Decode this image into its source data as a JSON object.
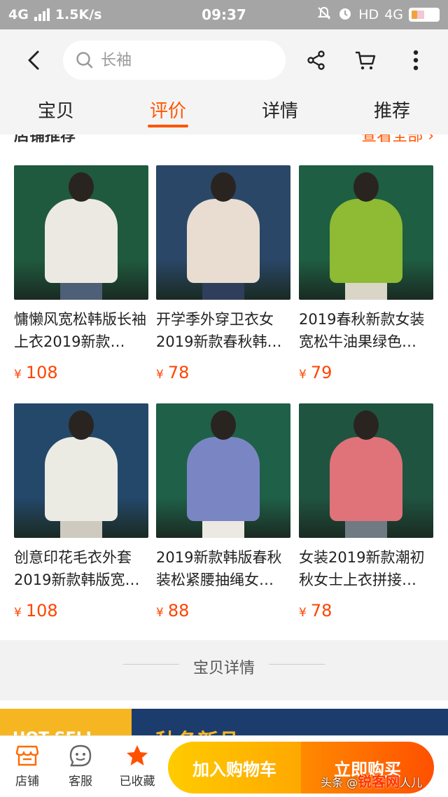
{
  "status_bar": {
    "network": "4G",
    "speed": "1.5K/s",
    "time": "09:37",
    "hd": "HD",
    "network_right": "4G"
  },
  "header": {
    "search_placeholder": "长袖",
    "tabs": [
      {
        "label": "宝贝",
        "active": false
      },
      {
        "label": "评价",
        "active": true
      },
      {
        "label": "详情",
        "active": false
      },
      {
        "label": "推荐",
        "active": false
      }
    ]
  },
  "section": {
    "title": "店铺推荐",
    "more": "查看全部"
  },
  "products": [
    {
      "name": "慵懒风宽松韩版长袖上衣2019新款…",
      "currency": "¥",
      "price": "108",
      "bg": "#1f5a3e",
      "top_color": "#ece9e2",
      "legs_color": "#4e5f78"
    },
    {
      "name": "开学季外穿卫衣女2019新款春秋韩…",
      "currency": "¥",
      "price": "78",
      "bg": "#2a4768",
      "top_color": "#e8ddd0",
      "legs_color": "#2f3e5a"
    },
    {
      "name": "2019春秋新款女装宽松牛油果绿色…",
      "currency": "¥",
      "price": "79",
      "bg": "#1e5e42",
      "top_color": "#8eba34",
      "legs_color": "#d9d6c8"
    },
    {
      "name": "创意印花毛衣外套2019新款韩版宽…",
      "currency": "¥",
      "price": "108",
      "bg": "#24486a",
      "top_color": "#ecebe3",
      "legs_color": "#cfcac0"
    },
    {
      "name": "2019新款韩版春秋装松紧腰抽绳女…",
      "currency": "¥",
      "price": "88",
      "bg": "#1f6048",
      "top_color": "#7a86c4",
      "legs_color": "#ece8e2"
    },
    {
      "name": "女装2019新款潮初秋女士上衣拼接…",
      "currency": "¥",
      "price": "78",
      "bg": "#1f5440",
      "top_color": "#e0727a",
      "legs_color": "#6f7a82"
    }
  ],
  "detail_label": "宝贝详情",
  "banner": {
    "left_text": "HOT SELL",
    "right_text": "秋冬新品"
  },
  "bottom_bar": {
    "shop_label": "店铺",
    "service_label": "客服",
    "fav_label": "已收藏",
    "cart_label": "加入购物车",
    "buy_label": "立即购买"
  },
  "watermark": {
    "prefix": "头条 @",
    "brand": "锐客网",
    "suffix": "人儿"
  },
  "colors": {
    "accent": "#ff5500",
    "price": "#ff4400",
    "cart_gradient_start": "#ffcb00",
    "buy_gradient_end": "#ff5000"
  }
}
